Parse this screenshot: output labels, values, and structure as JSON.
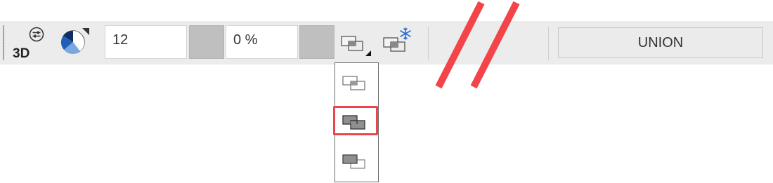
{
  "toolbar": {
    "mode_3d_label": "3D",
    "size_value": "12",
    "opacity_value": "0 %",
    "union_label": "UNION"
  },
  "colors": {
    "toolbar_bg": "#ececec",
    "swatch": "#bfbfbf",
    "highlight": "#e9464d",
    "slash_marks": "#f24449",
    "pie_blue": "#1f5fb5"
  },
  "icons": {
    "mode_settings": "sliders-icon",
    "render_style": "pie-render-icon",
    "overlap_mode": "overlap-rectangles-icon",
    "freeze_overlap": "snowflake-overlap-icon"
  },
  "overlap_dropdown": {
    "items": [
      {
        "name": "outline-overlap",
        "selected": false
      },
      {
        "name": "filled-overlap",
        "selected": true
      },
      {
        "name": "back-filled-overlap",
        "selected": false
      }
    ]
  }
}
